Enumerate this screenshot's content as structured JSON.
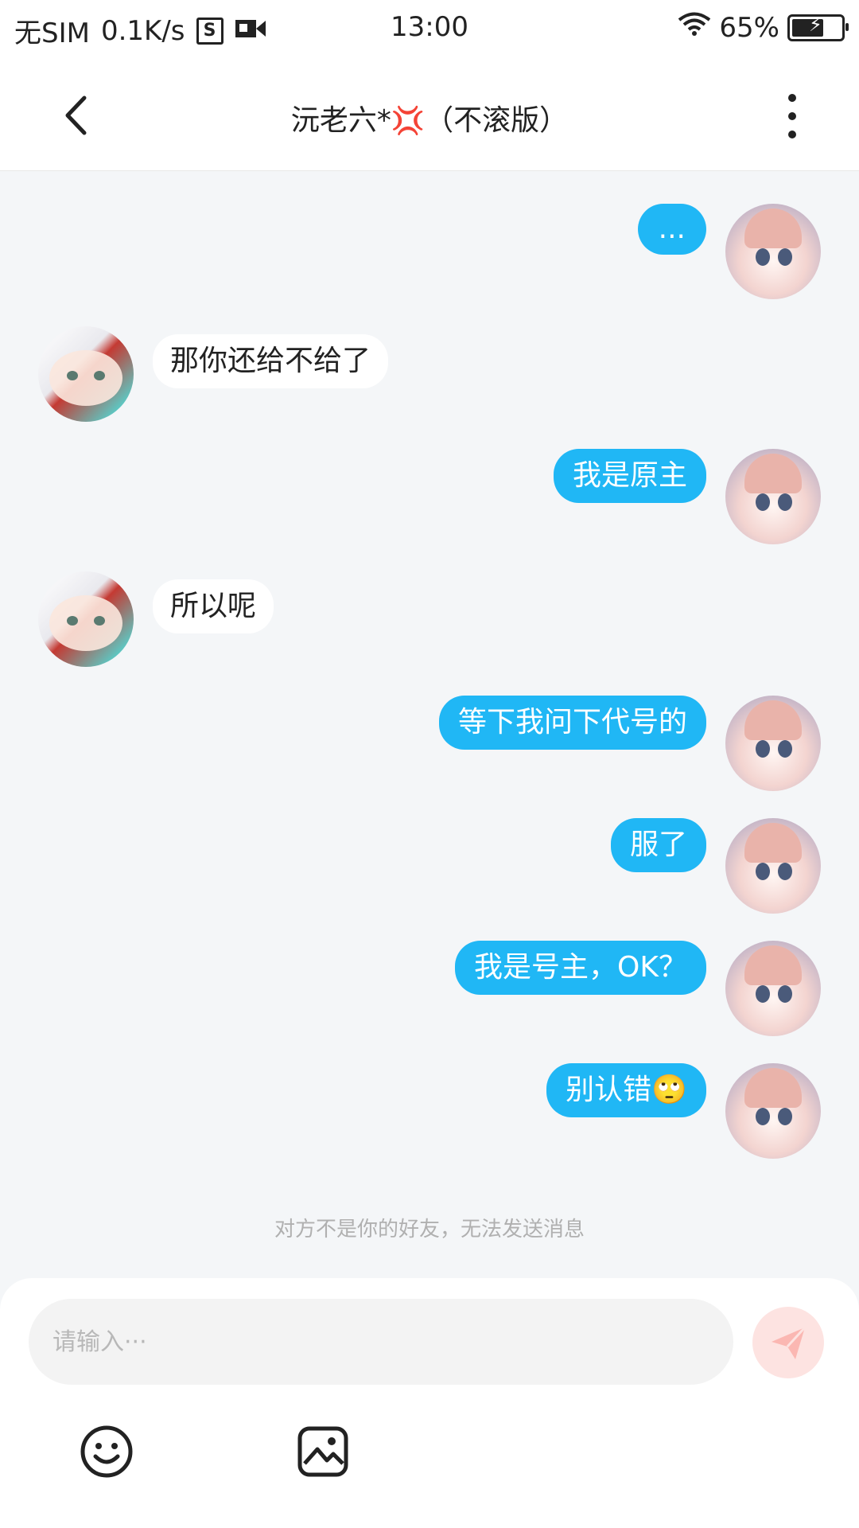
{
  "status_bar": {
    "carrier": "无SIM",
    "speed": "0.1K/s",
    "time": "13:00",
    "battery": "65%",
    "battery_level": 0.65
  },
  "header": {
    "title_prefix": "沅老六*",
    "title_emoji": "💢",
    "title_suffix": "（不滚版）"
  },
  "messages": [
    {
      "from": "me",
      "text": "..."
    },
    {
      "from": "other",
      "text": "那你还给不给了"
    },
    {
      "from": "me",
      "text": "我是原主"
    },
    {
      "from": "other",
      "text": "所以呢"
    },
    {
      "from": "me",
      "text": "等下我问下代号的"
    },
    {
      "from": "me",
      "text": "服了"
    },
    {
      "from": "me",
      "text": "我是号主，OK？"
    },
    {
      "from": "me",
      "text": "别认错🙄"
    }
  ],
  "notice": "对方不是你的好友，无法发送消息",
  "input": {
    "placeholder": "请输入···"
  },
  "colors": {
    "my_bubble": "#20b7f5",
    "other_bubble": "#ffffff",
    "send_button": "#fde3e1",
    "background": "#f4f6f8"
  },
  "icons": {
    "back": "chevron-left-icon",
    "more": "more-vertical-icon",
    "send": "send-icon",
    "emoji": "smiley-icon",
    "image": "image-icon"
  }
}
